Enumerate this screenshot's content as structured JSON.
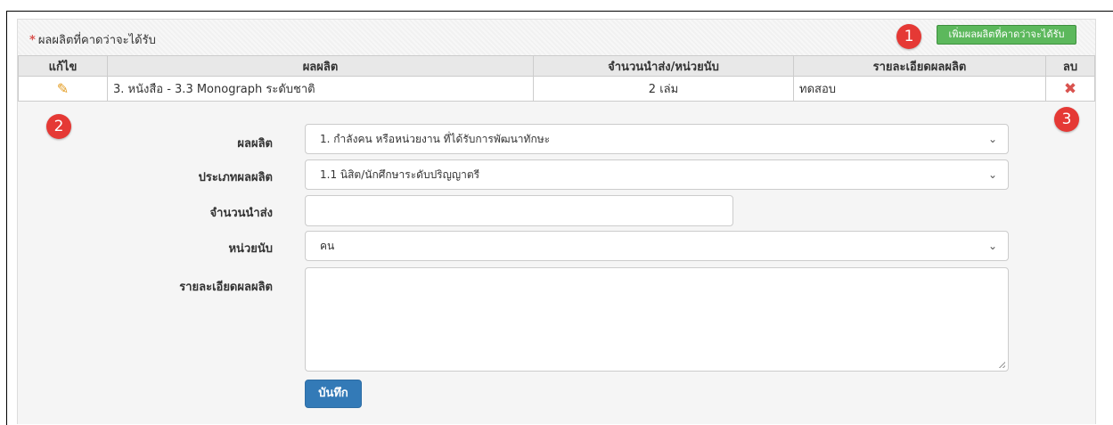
{
  "panel": {
    "required_mark": "*",
    "title": "ผลผลิตที่คาดว่าจะได้รับ",
    "add_button_label": "เพิ่มผลผลิตที่คาดว่าจะได้รับ"
  },
  "callouts": [
    "1",
    "2",
    "3"
  ],
  "table": {
    "columns": [
      "แก้ไข",
      "ผลผลิต",
      "จำนวนนำส่ง/หน่วยนับ",
      "รายละเอียดผลผลิต",
      "ลบ"
    ],
    "rows": [
      {
        "edit_icon": "pencil-icon",
        "product": "3. หนังสือ - 3.3 Monograph ระดับชาติ",
        "quantity_unit": "2 เล่ม",
        "detail": "ทดสอบ",
        "delete_icon": "delete-x-icon"
      }
    ]
  },
  "form": {
    "product_label": "ผลผลิต",
    "product_value": "1. กำลังคน หรือหน่วยงาน ที่ได้รับการพัฒนาทักษะ",
    "type_label": "ประเภทผลผลิต",
    "type_value": "1.1 นิสิต/นักศึกษาระดับปริญญาตรี",
    "quantity_label": "จำนวนนำส่ง",
    "quantity_value": "",
    "unit_label": "หน่วยนับ",
    "unit_value": "คน",
    "detail_label": "รายละเอียดผลผลิต",
    "detail_value": "",
    "save_label": "บันทึก"
  },
  "colors": {
    "add_button": "#5cb85c",
    "save_button": "#337ab7",
    "callout_badge": "#e53935",
    "delete_icon": "#d9534f",
    "edit_icon": "#e39b1f"
  }
}
